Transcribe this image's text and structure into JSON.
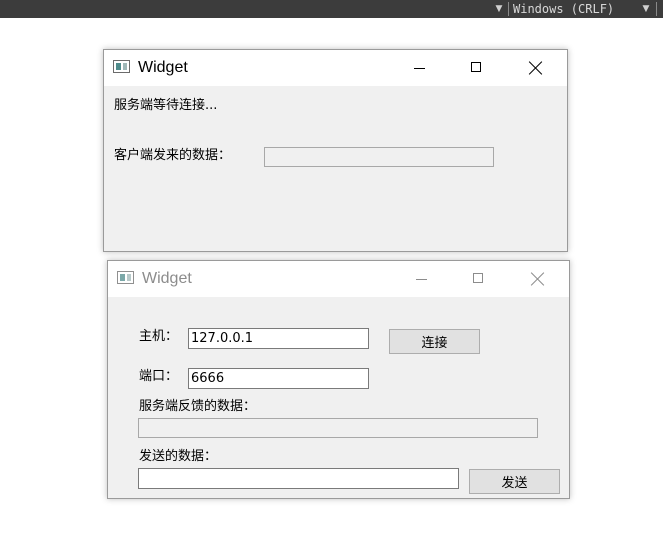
{
  "statusbar": {
    "encoding": "Windows (CRLF)"
  },
  "server_window": {
    "title": "Widget",
    "status": "服务端等待连接...",
    "received_label": "客户端发来的数据：",
    "received_value": ""
  },
  "client_window": {
    "title": "Widget",
    "host_label": "主机：",
    "host_value": "127.0.0.1",
    "connect_button": "连接",
    "port_label": "端口：",
    "port_value": "6666",
    "feedback_label": "服务端反馈的数据：",
    "feedback_value": "",
    "send_label": "发送的数据：",
    "send_value": "",
    "send_button": "发送"
  }
}
